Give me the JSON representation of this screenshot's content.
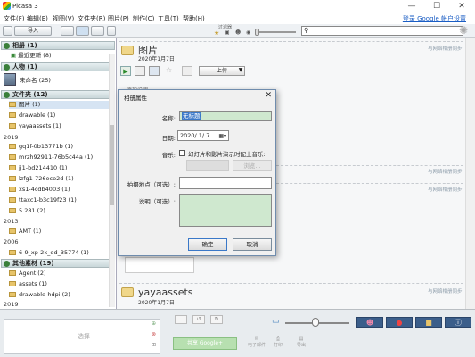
{
  "window": {
    "title": "Picasa 3"
  },
  "menu": [
    "文件(F)",
    "编辑(E)",
    "视图(V)",
    "文件夹(R)",
    "图片(P)",
    "制作(C)",
    "工具(T)",
    "帮助(H)"
  ],
  "signin": "登录 Google 帐户设置",
  "toolbar": {
    "import": "导入",
    "filter_label": "过滤器"
  },
  "sidebar": {
    "albums": "相册 (1)",
    "recent": "最近更新 (8)",
    "people": "人物 (1)",
    "unnamed": "未命名 (25)",
    "folders": "文件夹 (12)",
    "items_a": [
      "图片 (1)",
      "drawable (1)",
      "yayaassets (1)"
    ],
    "year_2019": "2019",
    "items_b": [
      "gq1f-0b13771b (1)",
      "mrzh92911-76b5c44a (1)",
      "jj1-bd214410 (1)",
      "lzfg1-726ece2d (1)",
      "xs1-4cdb4003 (1)",
      "ttaxc1-b3c19f23 (1)",
      "5.281 (2)"
    ],
    "year_2013": "2013",
    "items_c": [
      "AMT (1)"
    ],
    "year_2006": "2006",
    "items_d": [
      "6-9_xp-2k_dd_35774 (1)"
    ],
    "other": "其他素材 (19)",
    "items_e": [
      "Agent (2)",
      "assets (1)",
      "drawable-hdpi (2)"
    ],
    "year_bottom": "2019"
  },
  "main": {
    "folder1": {
      "name": "图片",
      "date": "2020年1月7日",
      "share": "与网络相册同步",
      "upload": "上传",
      "caption_hint": "添加说明"
    },
    "folder2": {
      "share": "与网络相册同步"
    },
    "folder3": {
      "share": "与网络相册同步"
    },
    "folder4": {
      "name": "yayaassets",
      "date": "2020年1月7日",
      "share": "与网络相册同步"
    }
  },
  "dialog": {
    "title": "相册属性",
    "name_label": "名称:",
    "name_value": "无标题",
    "date_label": "日期:",
    "date_value": "2020/ 1/ 7",
    "music_label": "音乐:",
    "music_check": "幻灯片和影片演示时配上音乐:",
    "browse": "浏览...",
    "place_label": "拍摄地点（可选）:",
    "desc_label": "说明（可选）:",
    "ok": "确定",
    "cancel": "取消"
  },
  "bottom": {
    "select": "选择",
    "share_btn": "共享 Google+",
    "email": "电子邮件",
    "print": "打印",
    "export": "导出"
  }
}
